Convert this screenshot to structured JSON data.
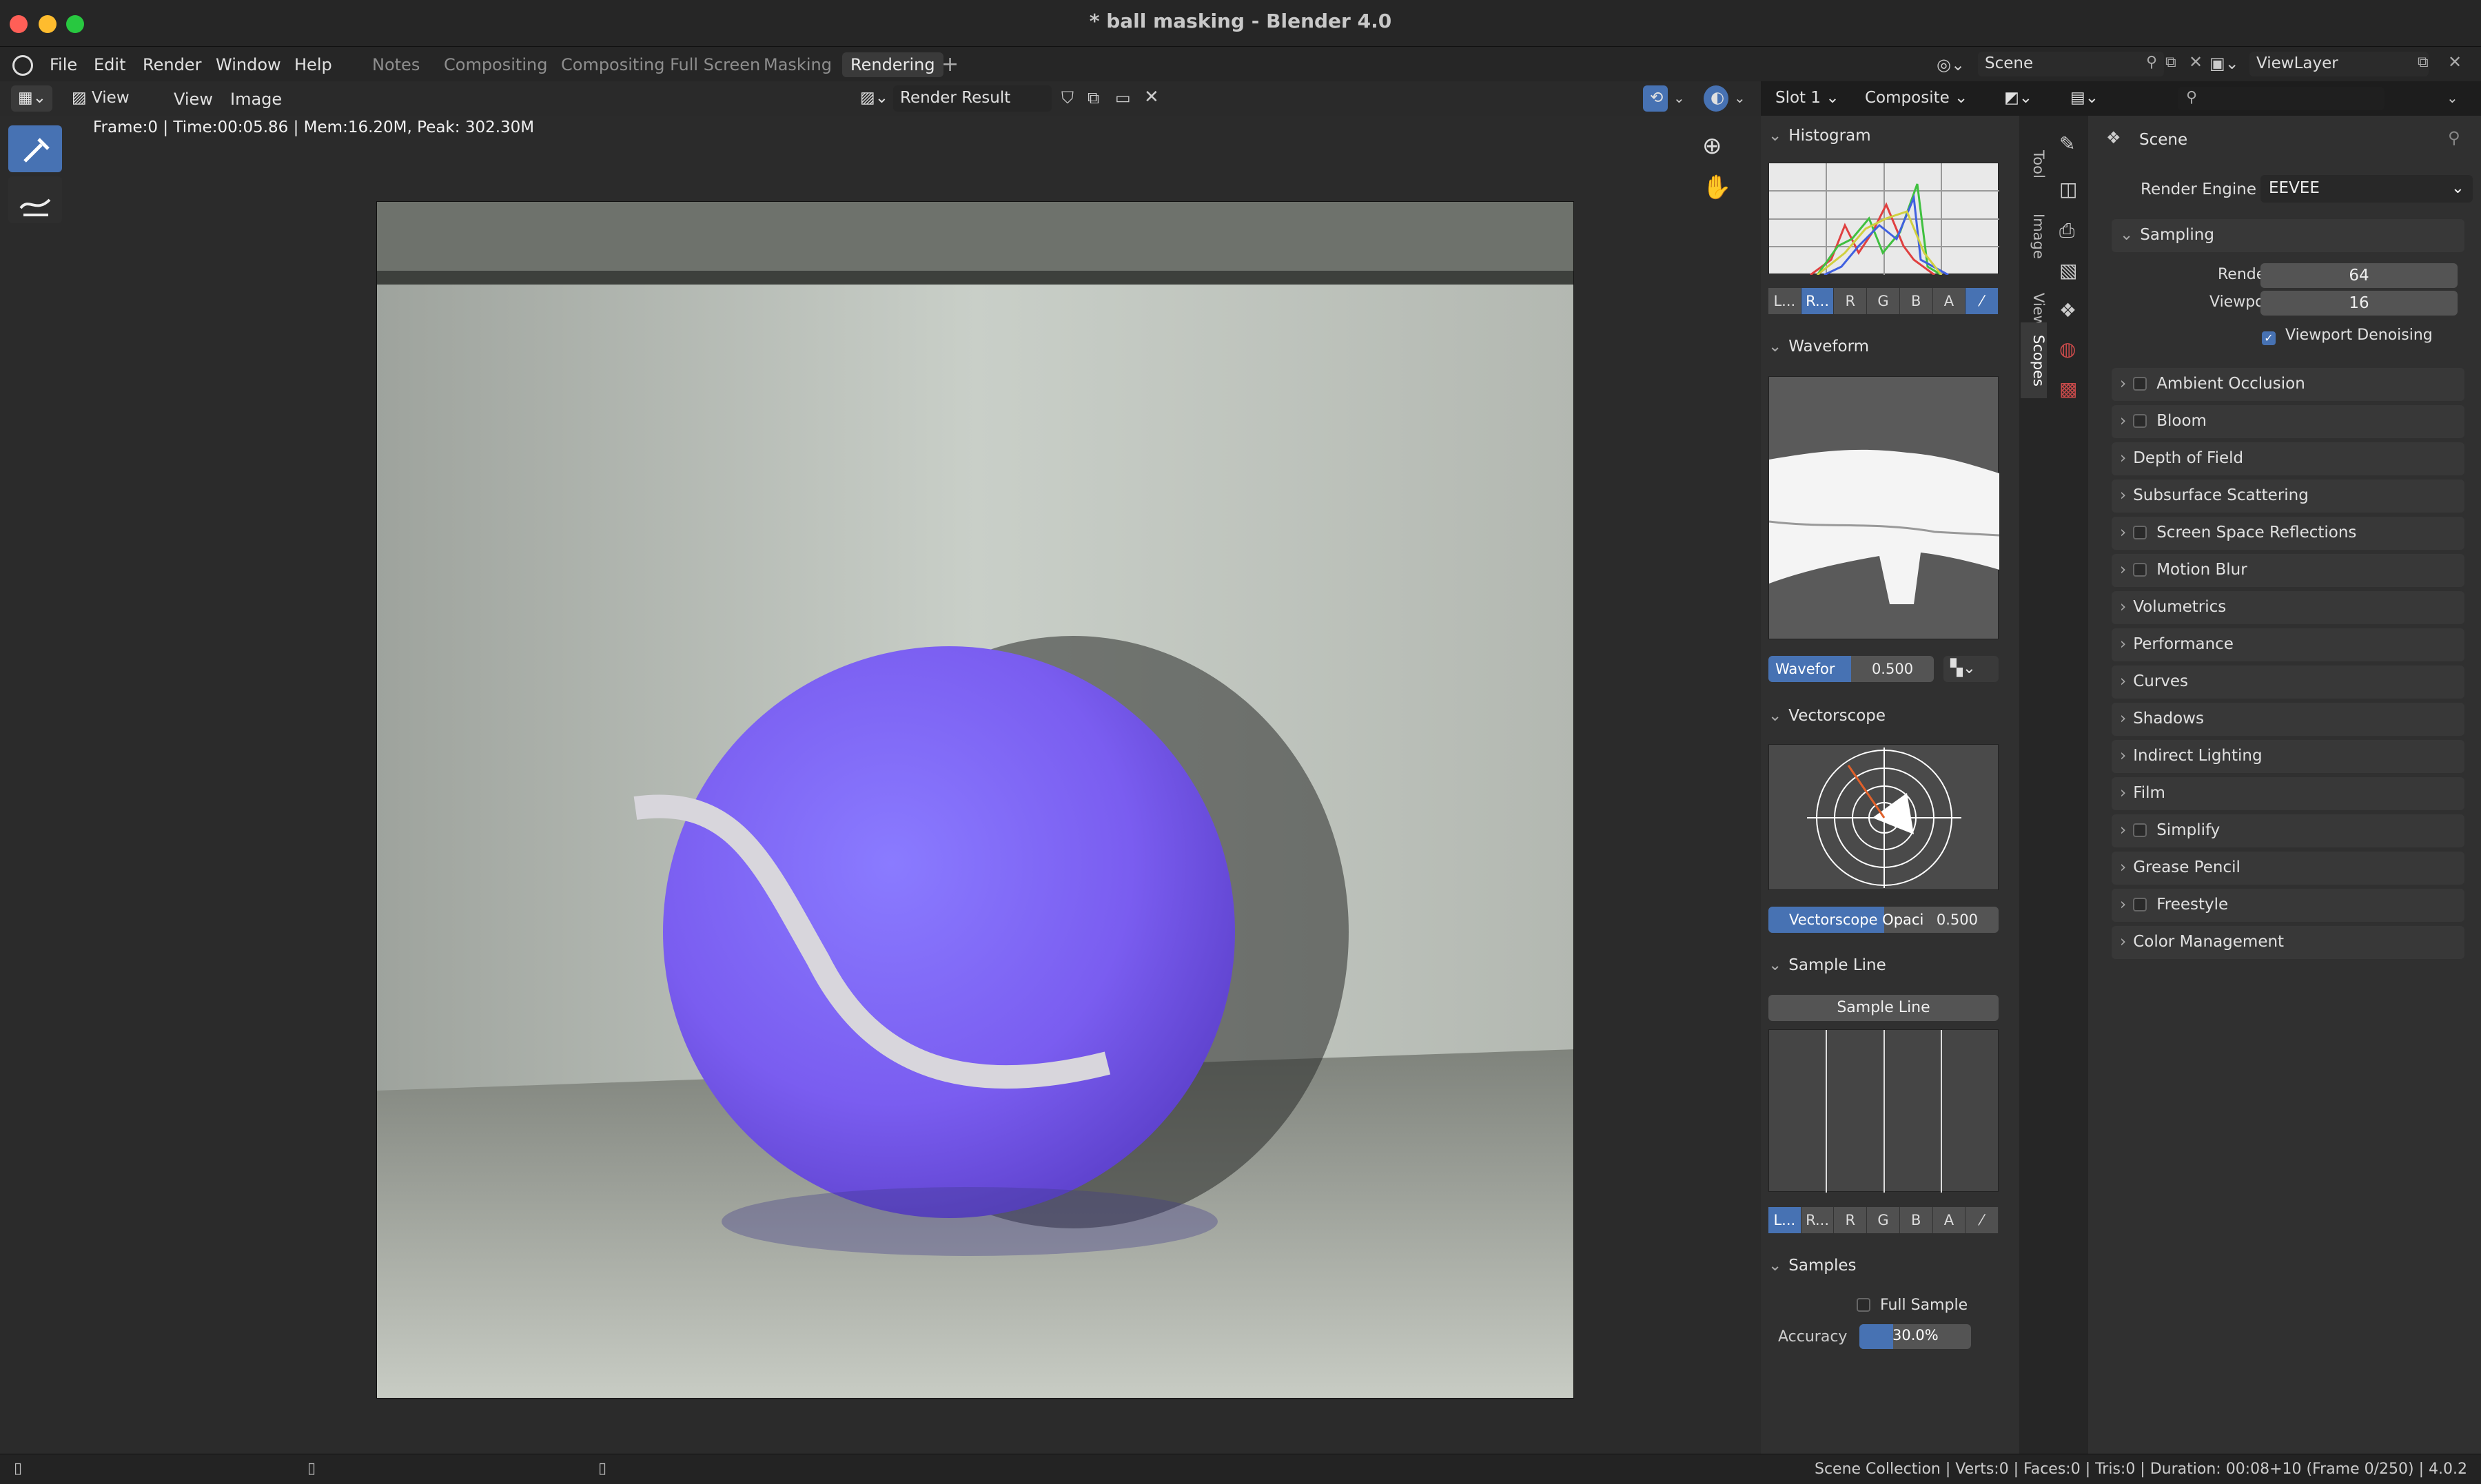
{
  "window": {
    "title": "* ball masking - Blender 4.0"
  },
  "menu": [
    "File",
    "Edit",
    "Render",
    "Window",
    "Help"
  ],
  "workspaces": [
    "Notes",
    "Compositing",
    "Compositing Full Screen",
    "Masking",
    "Rendering"
  ],
  "active_workspace": "Rendering",
  "scene_field": "Scene",
  "viewlayer_field": "ViewLayer",
  "image_header": {
    "view_menu": "View",
    "view2": "View",
    "image_menu": "Image",
    "render_result": "Render Result",
    "slot": "Slot 1",
    "pass": "Composite"
  },
  "stats_line": "Frame:0 | Time:00:05.86 | Mem:16.20M, Peak: 302.30M",
  "scopes": {
    "histogram": {
      "title": "Histogram",
      "channels": [
        "L...",
        "R...",
        "R",
        "G",
        "B",
        "A"
      ]
    },
    "waveform": {
      "title": "Waveform",
      "mode": "Wavefor",
      "opacity": "0.500"
    },
    "vectorscope": {
      "title": "Vectorscope",
      "label": "Vectorscope Opaci",
      "opacity": "0.500"
    },
    "sample_line": {
      "title": "Sample Line",
      "button": "Sample Line",
      "channels": [
        "L...",
        "R...",
        "R",
        "G",
        "B",
        "A"
      ]
    },
    "samples": {
      "title": "Samples",
      "full_sample": "Full Sample",
      "accuracy_label": "Accuracy",
      "accuracy": "30.0%"
    }
  },
  "sidebar_tabs": [
    "Tool",
    "Image",
    "View",
    "Scopes"
  ],
  "properties": {
    "context": "Scene",
    "render_engine_label": "Render Engine",
    "render_engine": "EEVEE",
    "sampling": "Sampling",
    "render_label": "Render",
    "render_value": "64",
    "viewport_label": "Viewport",
    "viewport_value": "16",
    "viewport_denoising": "Viewport Denoising",
    "panels": [
      {
        "label": "Ambient Occlusion",
        "checkbox": true
      },
      {
        "label": "Bloom",
        "checkbox": true
      },
      {
        "label": "Depth of Field",
        "checkbox": false
      },
      {
        "label": "Subsurface Scattering",
        "checkbox": false
      },
      {
        "label": "Screen Space Reflections",
        "checkbox": true
      },
      {
        "label": "Motion Blur",
        "checkbox": true
      },
      {
        "label": "Volumetrics",
        "checkbox": false
      },
      {
        "label": "Performance",
        "checkbox": false
      },
      {
        "label": "Curves",
        "checkbox": false
      },
      {
        "label": "Shadows",
        "checkbox": false
      },
      {
        "label": "Indirect Lighting",
        "checkbox": false
      },
      {
        "label": "Film",
        "checkbox": false
      },
      {
        "label": "Simplify",
        "checkbox": true
      },
      {
        "label": "Grease Pencil",
        "checkbox": false
      },
      {
        "label": "Freestyle",
        "checkbox": true
      },
      {
        "label": "Color Management",
        "checkbox": false
      }
    ]
  },
  "status_bar": "Scene Collection | Verts:0 | Faces:0 | Tris:0 | Duration: 00:08+10 (Frame 0/250) | 4.0.2"
}
